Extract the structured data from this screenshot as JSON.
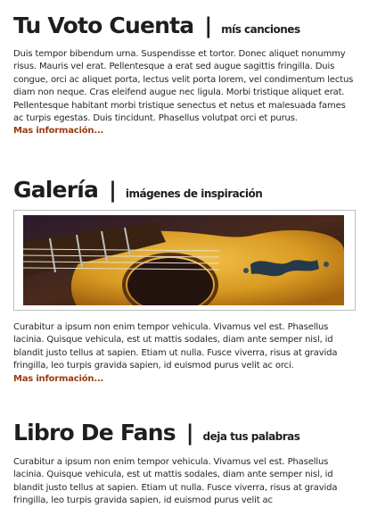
{
  "section1": {
    "title": "Tu Voto Cuenta",
    "separator": "|",
    "subtitle": "mís canciones",
    "body": "Duis tempor bibendum urna. Suspendisse et tortor. Donec aliquet nonummy risus. Mauris vel erat. Pellentesque a erat sed augue sagittis fringilla. Duis congue, orci ac aliquet porta, lectus velit porta lorem, vel condimentum lectus diam non neque. Cras eleifend augue nec ligula. Morbi tristique aliquet erat. Pellentesque habitant morbi tristique senectus et netus et malesuada fames ac turpis egestas. Duis tincidunt. Phasellus volutpat orci et purus.",
    "more_link": "Mas información..."
  },
  "section2": {
    "title": "Galería",
    "separator": "|",
    "subtitle": "imágenes de inspiración",
    "body": "Curabitur a ipsum non enim tempor vehicula. Vivamus vel est. Phasellus lacinia. Quisque vehicula, est ut mattis sodales, diam ante semper nisl, id blandit justo tellus at sapien. Etiam ut nulla. Fusce viverra, risus at gravida fringilla, leo turpis gravida sapien, id euismod purus velit ac orci.",
    "more_link": "Mas información..."
  },
  "section3": {
    "title": "Libro De Fans",
    "separator": "|",
    "subtitle": "deja tus palabras",
    "body": "Curabitur a ipsum non enim tempor vehicula. Vivamus vel est. Phasellus lacinia. Quisque vehicula, est ut mattis sodales, diam ante semper nisl, id blandit justo tellus at sapien. Etiam ut nulla. Fusce viverra, risus at gravida fringilla, leo turpis gravida sapien, id euismod purus velit ac"
  },
  "colors": {
    "heading": "#1e1e1e",
    "text": "#262626",
    "link": "#9a3b12",
    "image_border": "#bdbdbd"
  }
}
